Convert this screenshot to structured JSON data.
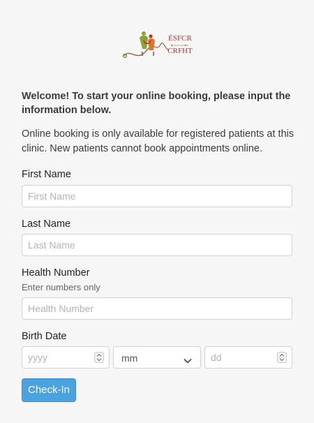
{
  "logo": {
    "line1": "ÉSFCR",
    "line2": "CRFHT",
    "colors": {
      "green": "#8aa33a",
      "orange": "#d97a2b",
      "red": "#b8322a",
      "brown": "#8a6a3a"
    }
  },
  "welcome_text": "Welcome! To start your online booking, please input the information below.",
  "intro_text": "Online booking is only available for registered patients at this clinic. New patients cannot book appointments online.",
  "form": {
    "first_name": {
      "label": "First Name",
      "placeholder": "First Name",
      "value": ""
    },
    "last_name": {
      "label": "Last Name",
      "placeholder": "Last Name",
      "value": ""
    },
    "health_number": {
      "label": "Health Number",
      "help": "Enter numbers only",
      "placeholder": "Health Number",
      "value": ""
    },
    "birth_date": {
      "label": "Birth Date",
      "year_placeholder": "yyyy",
      "month_selected": "mm",
      "day_placeholder": "dd"
    }
  },
  "submit_label": "Check-In",
  "colors": {
    "button_bg": "#4aa3df",
    "button_text": "#ffffff",
    "page_bg": "#f6f6f6"
  }
}
